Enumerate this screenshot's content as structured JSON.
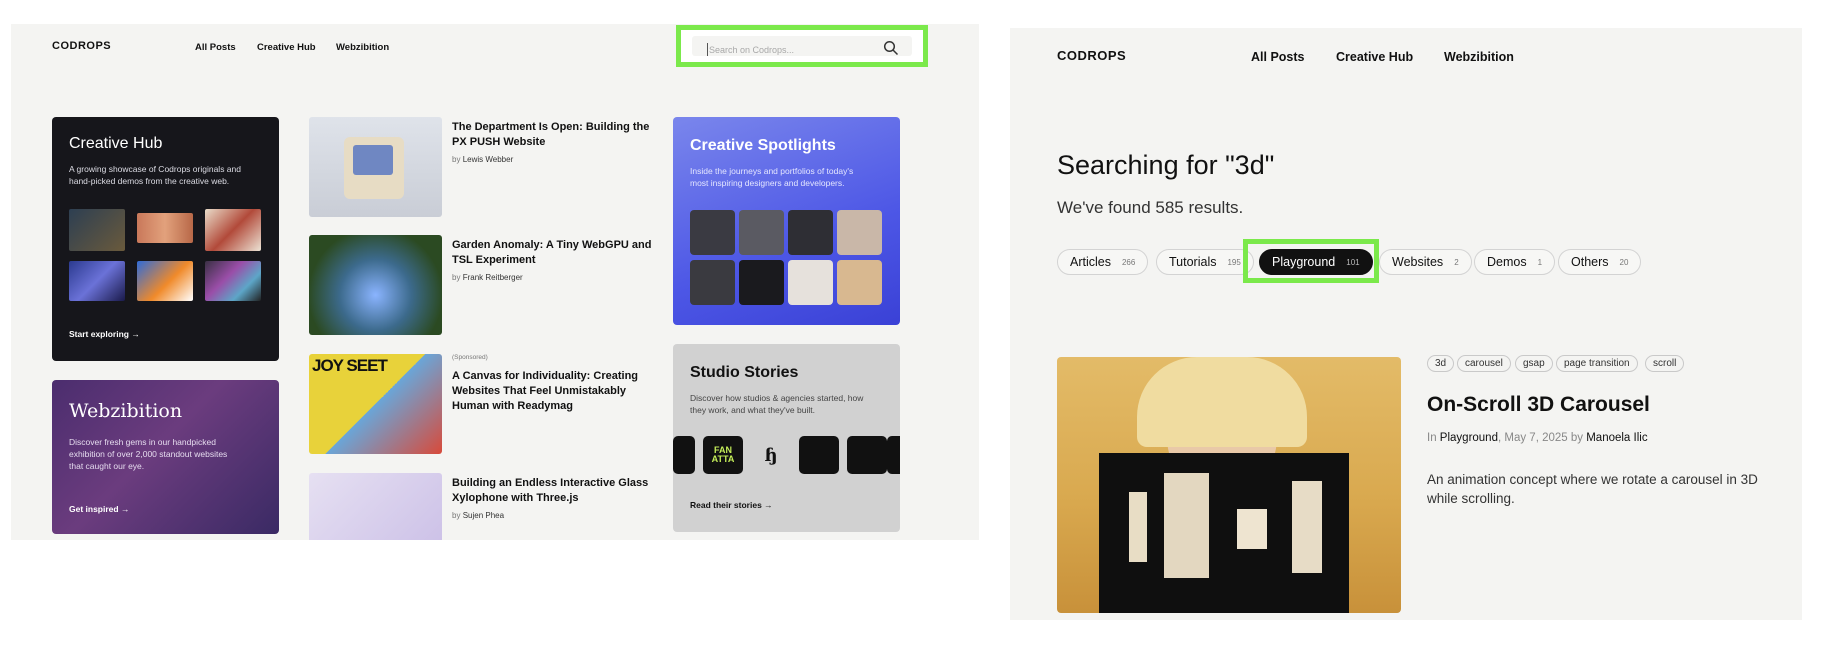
{
  "left": {
    "logo": "CODROPS",
    "nav": [
      "All Posts",
      "Creative Hub",
      "Webzibition"
    ],
    "search": {
      "placeholder": "Search on Codrops..."
    },
    "hub": {
      "title": "Creative Hub",
      "desc": "A growing showcase of Codrops originals and hand-picked demos from the creative web.",
      "cta": "Start exploring →"
    },
    "webzibition": {
      "title": "Webzibition",
      "desc": "Discover fresh gems in our handpicked exhibition of over 2,000 standout websites that caught our eye.",
      "cta": "Get inspired →"
    },
    "spotlights": {
      "title": "Creative Spotlights",
      "desc": "Inside the journeys and portfolios of today's most inspiring designers and developers."
    },
    "studio": {
      "title": "Studio Stories",
      "desc": "Discover how studios & agencies started, how they work, and what they've built.",
      "cta": "Read their stories →",
      "logos": [
        "FAN ATTA",
        "b."
      ]
    },
    "articles": [
      {
        "title": "The Department Is Open: Building the PX PUSH Website",
        "by": "by",
        "author": "Lewis Webber"
      },
      {
        "title": "Garden Anomaly: A Tiny WebGPU and TSL Experiment",
        "by": "by",
        "author": "Frank Reitberger"
      },
      {
        "label": "(Sponsored)",
        "title": "A Canvas for Individuality: Creating Websites That Feel Unmistakably Human with Readymag",
        "thumb_text": "JOY SEET"
      },
      {
        "title": "Building an Endless Interactive Glass Xylophone with Three.js",
        "by": "by",
        "author": "Sujen Phea"
      }
    ]
  },
  "right": {
    "logo": "CODROPS",
    "nav": [
      "All Posts",
      "Creative Hub",
      "Webzibition"
    ],
    "heading": "Searching for \"3d\"",
    "subheading": "We've found 585 results.",
    "filters": [
      {
        "label": "Articles",
        "count": "266"
      },
      {
        "label": "Tutorials",
        "count": "195"
      },
      {
        "label": "Playground",
        "count": "101"
      },
      {
        "label": "Websites",
        "count": "2"
      },
      {
        "label": "Demos",
        "count": "1"
      },
      {
        "label": "Others",
        "count": "20"
      }
    ],
    "result": {
      "tags": [
        "3d",
        "carousel",
        "gsap",
        "page transition",
        "scroll"
      ],
      "title": "On-Scroll 3D Carousel",
      "meta_in": "In",
      "category": "Playground",
      "date": ", May 7, 2025 by",
      "author": "Manoela Ilic",
      "desc": "An animation concept where we rotate a carousel in 3D while scrolling."
    }
  },
  "colors": {
    "highlight": "#7be94b",
    "accent_blue": "#4d57e6",
    "dark": "#111111"
  }
}
